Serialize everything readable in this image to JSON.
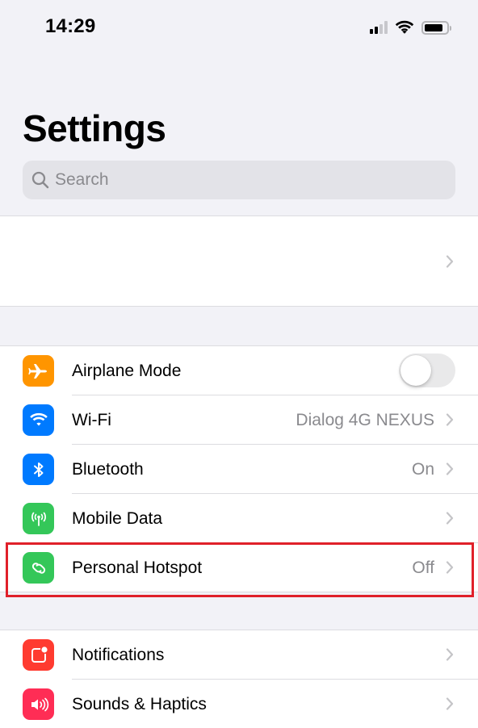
{
  "status_bar": {
    "time": "14:29",
    "signal_bars_filled": 2,
    "signal_bars_total": 4,
    "wifi_icon": "wifi-icon",
    "battery_level_percent": 85
  },
  "header": {
    "title": "Settings"
  },
  "search": {
    "placeholder": "Search",
    "value": "",
    "icon": "search-icon"
  },
  "profile": {
    "name": "",
    "chevron": "chevron-right-icon"
  },
  "connectivity": {
    "items": [
      {
        "label": "Airplane Mode",
        "icon": "airplane-icon",
        "icon_color": "#ff9500",
        "control": "toggle",
        "toggle_on": false
      },
      {
        "label": "Wi-Fi",
        "icon": "wifi-icon",
        "icon_color": "#007aff",
        "value": "Dialog 4G NEXUS",
        "control": "chevron"
      },
      {
        "label": "Bluetooth",
        "icon": "bluetooth-icon",
        "icon_color": "#007aff",
        "value": "On",
        "control": "chevron"
      },
      {
        "label": "Mobile Data",
        "icon": "antenna-icon",
        "icon_color": "#34c759",
        "value": "",
        "control": "chevron"
      },
      {
        "label": "Personal Hotspot",
        "icon": "hotspot-icon",
        "icon_color": "#34c759",
        "value": "Off",
        "control": "chevron",
        "highlighted": true
      }
    ]
  },
  "notifications_group": {
    "items": [
      {
        "label": "Notifications",
        "icon": "notifications-icon",
        "icon_color": "#ff3b30",
        "control": "chevron"
      },
      {
        "label": "Sounds & Haptics",
        "icon": "speaker-icon",
        "icon_color": "#ff2d55",
        "control": "chevron"
      }
    ]
  },
  "annotation": {
    "highlight_color": "#e0202a",
    "highlight_target": "Personal Hotspot"
  }
}
